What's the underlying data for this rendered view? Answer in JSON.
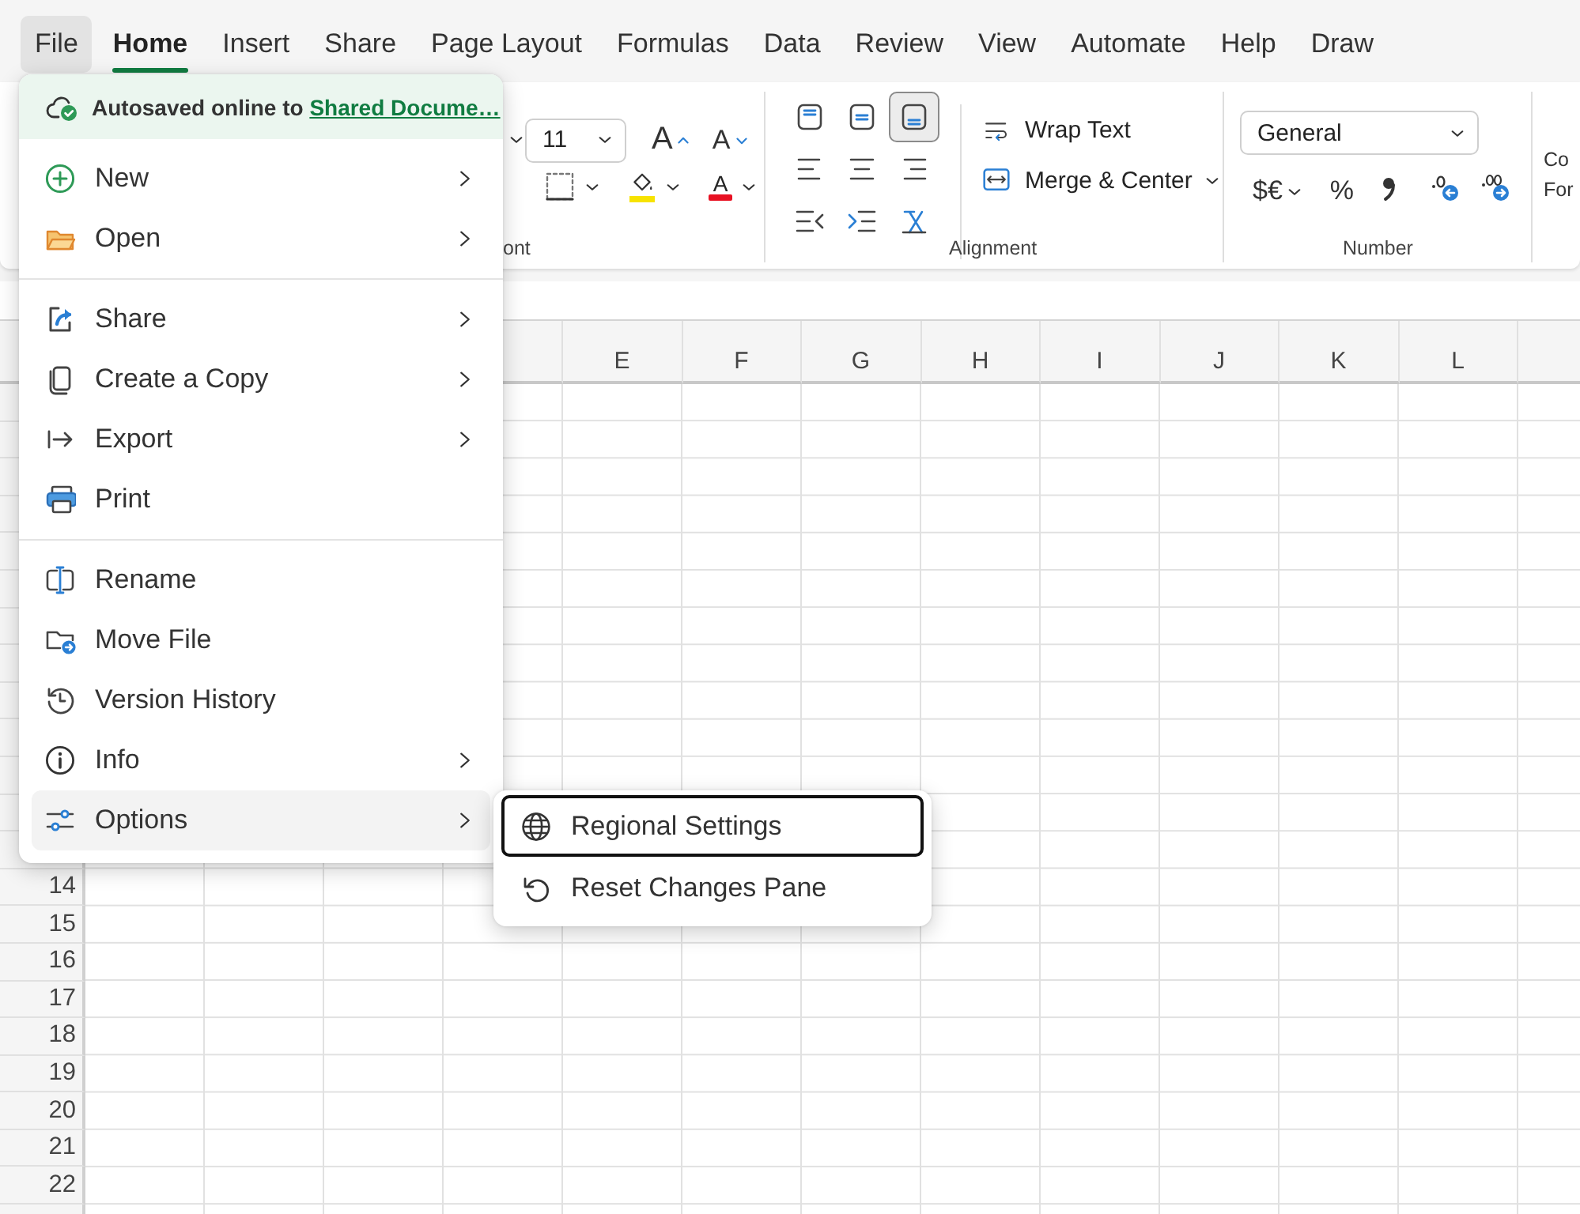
{
  "tabs": [
    {
      "label": "File",
      "selected": true,
      "active": false
    },
    {
      "label": "Home",
      "selected": false,
      "active": true
    },
    {
      "label": "Insert",
      "selected": false,
      "active": false
    },
    {
      "label": "Share",
      "selected": false,
      "active": false
    },
    {
      "label": "Page Layout",
      "selected": false,
      "active": false
    },
    {
      "label": "Formulas",
      "selected": false,
      "active": false
    },
    {
      "label": "Data",
      "selected": false,
      "active": false
    },
    {
      "label": "Review",
      "selected": false,
      "active": false
    },
    {
      "label": "View",
      "selected": false,
      "active": false
    },
    {
      "label": "Automate",
      "selected": false,
      "active": false
    },
    {
      "label": "Help",
      "selected": false,
      "active": false
    },
    {
      "label": "Draw",
      "selected": false,
      "active": false
    }
  ],
  "ribbon": {
    "font_group": {
      "size": "11",
      "grow": "A",
      "shrink": "A",
      "font_color": "A",
      "label": "ont"
    },
    "alignment_group": {
      "align_buttons": [
        {
          "selected": false
        },
        {
          "selected": false
        },
        {
          "selected": true
        },
        {
          "selected": false
        },
        {
          "selected": false
        },
        {
          "selected": false
        },
        {
          "selected": false
        },
        {
          "selected": false
        },
        {
          "selected": false
        }
      ],
      "wrap_text": "Wrap Text",
      "merge": "Merge & Center",
      "label": "Alignment"
    },
    "number_group": {
      "format": "General",
      "currency": "$€",
      "percent": "%",
      "label": "Number"
    },
    "partial_group": {
      "lines": [
        "Co",
        "For"
      ]
    }
  },
  "columns": [
    "E",
    "F",
    "G",
    "H",
    "I",
    "J",
    "K",
    "L"
  ],
  "rows": [
    "14",
    "15",
    "16",
    "17",
    "18",
    "19",
    "20",
    "21",
    "22"
  ],
  "file_menu": {
    "autosave": {
      "text": "Autosaved online to",
      "link": "Shared Docume…"
    },
    "sections": [
      [
        {
          "label": "New",
          "submenu": true,
          "selected": false
        },
        {
          "label": "Open",
          "submenu": true,
          "selected": false
        }
      ],
      [
        {
          "label": "Share",
          "submenu": true,
          "selected": false
        },
        {
          "label": "Create a Copy",
          "submenu": true,
          "selected": false
        },
        {
          "label": "Export",
          "submenu": true,
          "selected": false
        },
        {
          "label": "Print",
          "submenu": false,
          "selected": false
        }
      ],
      [
        {
          "label": "Rename",
          "submenu": false,
          "selected": false
        },
        {
          "label": "Move File",
          "submenu": false,
          "selected": false
        },
        {
          "label": "Version History",
          "submenu": false,
          "selected": false
        },
        {
          "label": "Info",
          "submenu": true,
          "selected": false
        },
        {
          "label": "Options",
          "submenu": true,
          "selected": true
        }
      ]
    ]
  },
  "options_submenu": [
    {
      "label": "Regional Settings",
      "selected": true
    },
    {
      "label": "Reset Changes Pane",
      "selected": false
    }
  ]
}
